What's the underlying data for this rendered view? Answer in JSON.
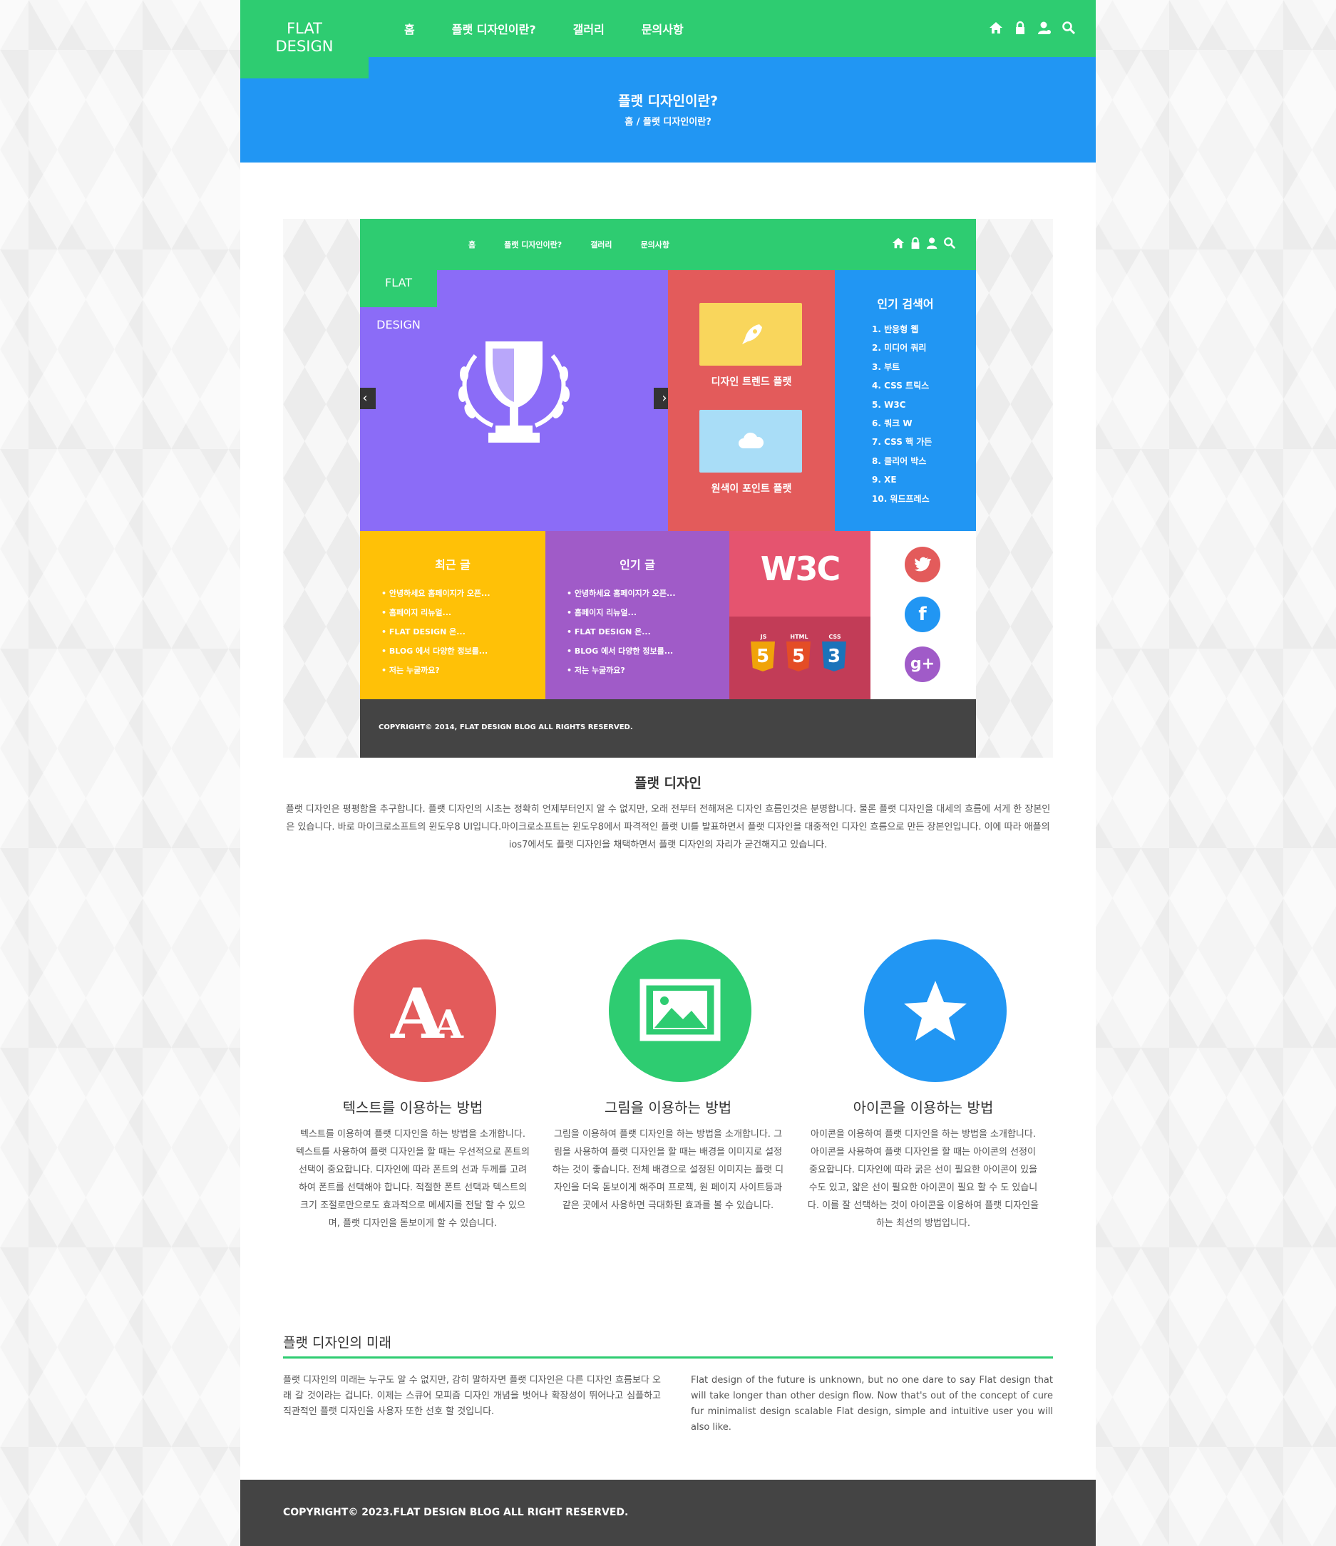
{
  "header": {
    "logo_line1": "FLAT",
    "logo_line2": "DESIGN",
    "nav": [
      "홈",
      "플랫 디자인이란?",
      "갤러리",
      "문의사항"
    ],
    "icons": [
      "home-icon",
      "lock-icon",
      "user-icon",
      "search-icon"
    ]
  },
  "banner": {
    "title": "플랫 디자인이란?",
    "breadcrumb": "홈 / 플랫 디자인이란?"
  },
  "mock": {
    "logo_line1": "FLAT",
    "logo_line2": "DESIGN",
    "nav": [
      "홈",
      "플랫 디자인이란?",
      "갤러리",
      "문의사항"
    ],
    "tile1_label": "디자인 트렌드 플랫",
    "tile2_label": "원색이 포인트 플랫",
    "search_title": "인기 검색어",
    "search_items": [
      "1. 반응형 웹",
      "2. 미디어 쿼리",
      "3. 부트",
      "4. CSS 트릭스",
      "5. W3C",
      "6. 쿼크 W",
      "7. CSS 핵 가든",
      "8. 클리어 박스",
      "9. XE",
      "10. 워드프레스"
    ],
    "recent_title": "최근 글",
    "popular_title": "인기 글",
    "posts": [
      "안녕하세요 홈페이지가 오픈...",
      "홈페이지 리뉴얼...",
      "FLAT DESIGN 은...",
      "BLOG 에서 다양한 정보를...",
      "저는 누굴까요?"
    ],
    "w3c": "W3C",
    "badges": [
      {
        "cap": "JS",
        "num": "5",
        "color": "#f0a30a"
      },
      {
        "cap": "HTML",
        "num": "5",
        "color": "#e44d26"
      },
      {
        "cap": "CSS",
        "num": "3",
        "color": "#1b73ba"
      }
    ],
    "footer": "COPYRIGHT© 2014, FLAT DESIGN BLOG ALL RIGHTS RESERVED."
  },
  "article": {
    "title": "플랫 디자인",
    "body": "플랫 디자인은 평평함을 추구합니다. 플랫 디자인의 시초는 정확히 언제부터인지 알 수 없지만, 오래 전부터 전해져온 디자인 흐름인것은 분명합니다. 물론 플랫 디자인을 대세의 흐름에 서게 한 장본인은 있습니다. 바로 마이크로소프트의 윈도우8 UI입니다.마이크로소프트는 윈도우8에서 파격적인 플랫 UI를 발표하면서 플랫 디자인을 대중적인 디자인 흐름으로 만든 장본인입니다. 이에 따라 애플의 ios7에서도 플랫 디자인을 채택하면서 플랫 디자인의 자리가 굳건해지고 있습니다."
  },
  "features": [
    {
      "title": "텍스트를 이용하는 방법",
      "body": "텍스트를 이용하여 플랫 디자인을 하는 방법을 소개합니다. 텍스트를 사용하여 플랫 디자인을 할 때는 우선적으로 폰트의 선택이 중요합니다. 디자인에 따라 폰트의 선과 두께를 고려하여 폰트를 선택해야 합니다. 적절한 폰트 선택과 텍스트의 크기 조절로만으로도 효과적으로 메세지를 전달 할 수 있으며, 플랫 디자인을 돋보이게 할 수 있습니다.",
      "color": "#e35b5b",
      "icon": "font-icon"
    },
    {
      "title": "그림을 이용하는 방법",
      "body": "그림을 이용하여 플랫 디자인을 하는 방법을 소개합니다. 그림을 사용하여 플랫 디자인을 할 때는 배경을 이미지로 설정 하는 것이 좋습니다. 전체 배경으로 설정된 이미지는 플랫 디자인을 더욱 돋보이게 해주며 프로젝, 원 페이지 사이트등과 같은 곳에서 사용하면 극대화된 효과를 볼 수 있습니다.",
      "color": "#2ecc71",
      "icon": "image-icon"
    },
    {
      "title": "아이콘을 이용하는 방법",
      "body": "아이콘을 이용하여 플랫 디자인을 하는 방법을 소개합니다. 아이콘을 사용하여 플랫 디자인을 할 때는 아이콘의 선정이 중요합니다. 디자인에 따라 굵은 선이 필요한 아이콘이 있을수도 있고, 얇은 선이 필요한 아이콘이 필요 할 수 도 있습니다. 이를 잘 선택하는 것이 아이콘을 이용하여 플랫 디자인을 하는 최선의 방법입니다.",
      "color": "#2196f3",
      "icon": "star-icon"
    }
  ],
  "future": {
    "title": "플랫 디자인의 미래",
    "ko": "플랫 디자인의 미래는 누구도 알 수 없지만, 감히 말하자면 플랫 디자인은 다른 디자인 흐름보다 오래 갈 것이라는 겁니다. 이제는 스큐어 모피즘 디자인 개념을 벗어나 확장성이 뛰어나고 심플하고 직관적인 플랫 디자인을 사용자 또한 선호 할 것입니다.",
    "en": "Flat design of the future is unknown, but no one dare to say Flat design that will take longer than other design flow. Now that's out of the concept of cure fur minimalist design scalable Flat design, simple and intuitive user you will also like."
  },
  "footer": {
    "text": "COPYRIGHT© 2023.FLAT DESIGN BLOG ALL RIGHT RESERVED."
  },
  "colors": {
    "green": "#2ecc71",
    "blue": "#2196f3",
    "red": "#e35b5b",
    "dark": "#444444"
  }
}
